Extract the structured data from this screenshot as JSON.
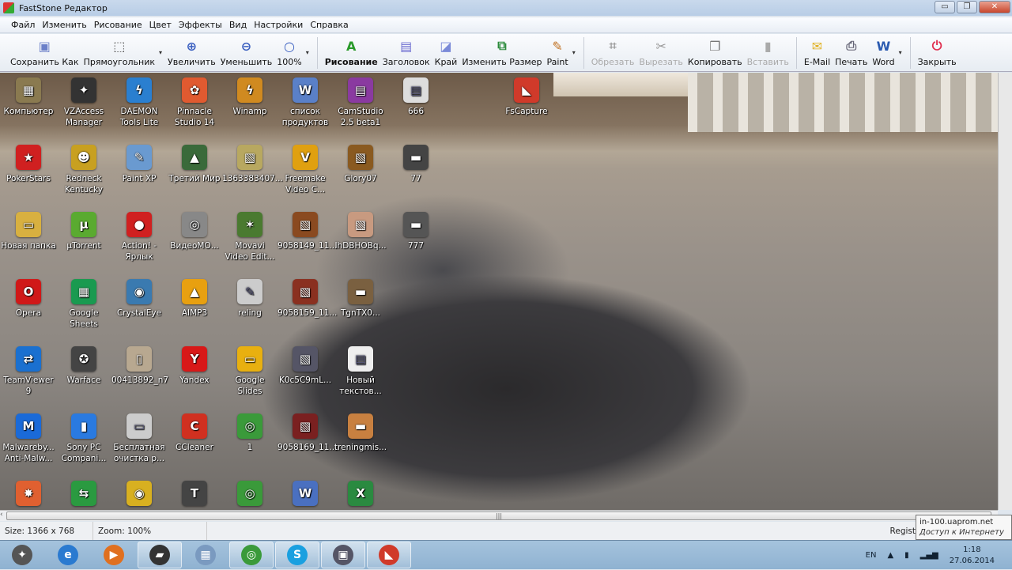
{
  "window": {
    "title": "FastStone Редактор",
    "buttons": [
      "minimize",
      "restore",
      "close"
    ]
  },
  "menu": [
    "Файл",
    "Изменить",
    "Рисование",
    "Цвет",
    "Эффекты",
    "Вид",
    "Настройки",
    "Справка"
  ],
  "toolbar": [
    {
      "label": "Сохранить Как",
      "icon": "save-icon",
      "glyph": "▣",
      "color": "#6a7fc8"
    },
    {
      "label": "Прямоугольник",
      "icon": "rectangle-select-icon",
      "glyph": "⬚",
      "color": "#555",
      "dropdown": true
    },
    {
      "label": "Увеличить",
      "icon": "zoom-in-icon",
      "glyph": "⊕",
      "color": "#3a5fc0"
    },
    {
      "label": "Уменьшить",
      "icon": "zoom-out-icon",
      "glyph": "⊖",
      "color": "#3a5fc0"
    },
    {
      "label": "100%",
      "icon": "zoom-actual-icon",
      "glyph": "○",
      "color": "#3a5fc0",
      "dropdown": true,
      "sep": true
    },
    {
      "label": "Рисование",
      "icon": "draw-icon",
      "glyph": "A",
      "color": "#2a9a2a",
      "bold": true
    },
    {
      "label": "Заголовок",
      "icon": "caption-icon",
      "glyph": "▤",
      "color": "#6a6ad0"
    },
    {
      "label": "Край",
      "icon": "edge-icon",
      "glyph": "◪",
      "color": "#7a8ad8"
    },
    {
      "label": "Изменить Размер",
      "icon": "resize-icon",
      "glyph": "⧉",
      "color": "#2a8a3a"
    },
    {
      "label": "Paint",
      "icon": "paint-icon",
      "glyph": "✎",
      "color": "#c07020",
      "dropdown": true,
      "sep": true
    },
    {
      "label": "Обрезать",
      "icon": "crop-icon",
      "glyph": "⌗",
      "color": "#999",
      "disabled": true
    },
    {
      "label": "Вырезать",
      "icon": "scissors-icon",
      "glyph": "✂",
      "color": "#999",
      "disabled": true
    },
    {
      "label": "Копировать",
      "icon": "copy-icon",
      "glyph": "❐",
      "color": "#777"
    },
    {
      "label": "Вставить",
      "icon": "paste-icon",
      "glyph": "▮",
      "color": "#aaa",
      "disabled": true,
      "sep": true
    },
    {
      "label": "E-Mail",
      "icon": "email-icon",
      "glyph": "✉",
      "color": "#e0b020"
    },
    {
      "label": "Печать",
      "icon": "print-icon",
      "glyph": "⎙",
      "color": "#667"
    },
    {
      "label": "Word",
      "icon": "word-icon",
      "glyph": "W",
      "color": "#2a5ab0",
      "dropdown": true,
      "sep": true
    },
    {
      "label": "Закрыть",
      "icon": "power-icon",
      "glyph": "⏻",
      "color": "#e03050"
    }
  ],
  "desktop_rows": [
    [
      {
        "label": "Компьютер",
        "color": "#8a7a50",
        "glyph": "▦"
      },
      {
        "label": "VZAccess Manager",
        "color": "#333",
        "glyph": "✦"
      },
      {
        "label": "DAEMON Tools Lite",
        "color": "#2a7fd0",
        "glyph": "ϟ"
      },
      {
        "label": "Pinnacle Studio 14",
        "color": "#e05a30",
        "glyph": "✿"
      },
      {
        "label": "Winamp",
        "color": "#d08a20",
        "glyph": "ϟ"
      },
      {
        "label": "список продуктов",
        "color": "#5a80c8",
        "glyph": "W"
      },
      {
        "label": "CamStudio 2.5 beta1",
        "color": "#8a3aa0",
        "glyph": "▤"
      },
      {
        "label": "666",
        "color": "#ddd",
        "glyph": "▤"
      },
      null,
      {
        "label": "FsCapture",
        "color": "#d03a2a",
        "glyph": "◣"
      }
    ],
    [
      {
        "label": "PokerStars",
        "color": "#d02020",
        "glyph": "★"
      },
      {
        "label": "Redneck Kentucky",
        "color": "#c8a020",
        "glyph": "☻"
      },
      {
        "label": "Paint XP",
        "color": "#6a9ad0",
        "glyph": "✎"
      },
      {
        "label": "Третий Мир",
        "color": "#3a6a3a",
        "glyph": "▲"
      },
      {
        "label": "1363383407...",
        "color": "#b8a860",
        "glyph": "▧"
      },
      {
        "label": "Freemake Video C...",
        "color": "#e0a010",
        "glyph": "V"
      },
      {
        "label": "Glory07",
        "color": "#8a5a20",
        "glyph": "▧"
      },
      {
        "label": "77",
        "color": "#444",
        "glyph": "▬"
      }
    ],
    [
      {
        "label": "Новая папка",
        "color": "#d8b040",
        "glyph": "▭"
      },
      {
        "label": "µTorrent",
        "color": "#5aaa30",
        "glyph": "µ"
      },
      {
        "label": "Action! - Ярлык",
        "color": "#d02020",
        "glyph": "●"
      },
      {
        "label": "ВидеоМО...",
        "color": "#888",
        "glyph": "◎"
      },
      {
        "label": "Movavi Video Edit...",
        "color": "#4a7a30",
        "glyph": "✶"
      },
      {
        "label": "9058149_11...",
        "color": "#8a4a20",
        "glyph": "▧"
      },
      {
        "label": "IhDBHOBq...",
        "color": "#c89a80",
        "glyph": "▧"
      },
      {
        "label": "777",
        "color": "#555",
        "glyph": "▬"
      }
    ],
    [
      {
        "label": "Opera",
        "color": "#d01818",
        "glyph": "O"
      },
      {
        "label": "Google Sheets",
        "color": "#1a9a50",
        "glyph": "▦"
      },
      {
        "label": "CrystalEye",
        "color": "#3a7ab0",
        "glyph": "◉"
      },
      {
        "label": "AIMP3",
        "color": "#e8a010",
        "glyph": "▲"
      },
      {
        "label": "reling",
        "color": "#ccc",
        "glyph": "✎"
      },
      {
        "label": "9058159_11...",
        "color": "#8a3020",
        "glyph": "▧"
      },
      {
        "label": "TgnTX0...",
        "color": "#7a6040",
        "glyph": "▬"
      }
    ],
    [
      {
        "label": "TeamViewer 9",
        "color": "#1a70d0",
        "glyph": "⇄"
      },
      {
        "label": "Warface",
        "color": "#444",
        "glyph": "✪"
      },
      {
        "label": "00413892_n7",
        "color": "#b8a890",
        "glyph": "▯"
      },
      {
        "label": "Yandex",
        "color": "#d81818",
        "glyph": "Y"
      },
      {
        "label": "Google Slides",
        "color": "#e8b010",
        "glyph": "▭"
      },
      {
        "label": "K0c5C9mL...",
        "color": "#556",
        "glyph": "▧"
      },
      {
        "label": "Новый текстов...",
        "color": "#eee",
        "glyph": "▤"
      }
    ],
    [
      {
        "label": "Malwareby... Anti-Malw...",
        "color": "#1a6ad8",
        "glyph": "M"
      },
      {
        "label": "Sony PC Compani...",
        "color": "#2a7ae0",
        "glyph": "▮"
      },
      {
        "label": "Бесплатная очистка р...",
        "color": "#ccc",
        "glyph": "▭"
      },
      {
        "label": "CCleaner",
        "color": "#d03020",
        "glyph": "C"
      },
      {
        "label": "1",
        "color": "#3a9a3a",
        "glyph": "◎"
      },
      {
        "label": "9058169_11...",
        "color": "#7a2020",
        "glyph": "▧"
      },
      {
        "label": "treningmis...",
        "color": "#c88040",
        "glyph": "▬"
      }
    ],
    [
      {
        "label": "",
        "color": "#e06030",
        "glyph": "✸"
      },
      {
        "label": "",
        "color": "#2a9a40",
        "glyph": "⇆"
      },
      {
        "label": "",
        "color": "#d8b020",
        "glyph": "◉"
      },
      {
        "label": "",
        "color": "#444",
        "glyph": "T"
      },
      {
        "label": "",
        "color": "#3a9a3a",
        "glyph": "◎"
      },
      {
        "label": "",
        "color": "#4a70c0",
        "glyph": "W"
      },
      {
        "label": "",
        "color": "#2a8a40",
        "glyph": "X"
      }
    ]
  ],
  "status": {
    "size": "Size: 1366 x 768",
    "zoom": "Zoom: 100%",
    "reg": "Regist"
  },
  "tooltip": {
    "host": "in-100.uaprom.net",
    "access": "Доступ к Интернету"
  },
  "taskbar": {
    "items": [
      {
        "icon": "start-icon",
        "color": "#555",
        "glyph": "✦"
      },
      {
        "icon": "internet-explorer-icon",
        "color": "#2a7ad0",
        "glyph": "e"
      },
      {
        "icon": "media-player-icon",
        "color": "#e07020",
        "glyph": "▶"
      },
      {
        "icon": "briefcase-icon",
        "color": "#333",
        "glyph": "▰",
        "open": true
      },
      {
        "icon": "calculator-icon",
        "color": "#7a9ac0",
        "glyph": "▦"
      },
      {
        "icon": "chrome-icon",
        "color": "#3a9a3a",
        "glyph": "◎",
        "open": true
      },
      {
        "icon": "skype-icon",
        "color": "#1aa0e0",
        "glyph": "S",
        "open": true
      },
      {
        "icon": "screen-recorder-icon",
        "color": "#556",
        "glyph": "▣",
        "open": true
      },
      {
        "icon": "faststone-capture-icon",
        "color": "#d03a2a",
        "glyph": "◣",
        "open": true
      }
    ],
    "lang": "EN",
    "time": "1:18",
    "date": "27.06.2014"
  }
}
